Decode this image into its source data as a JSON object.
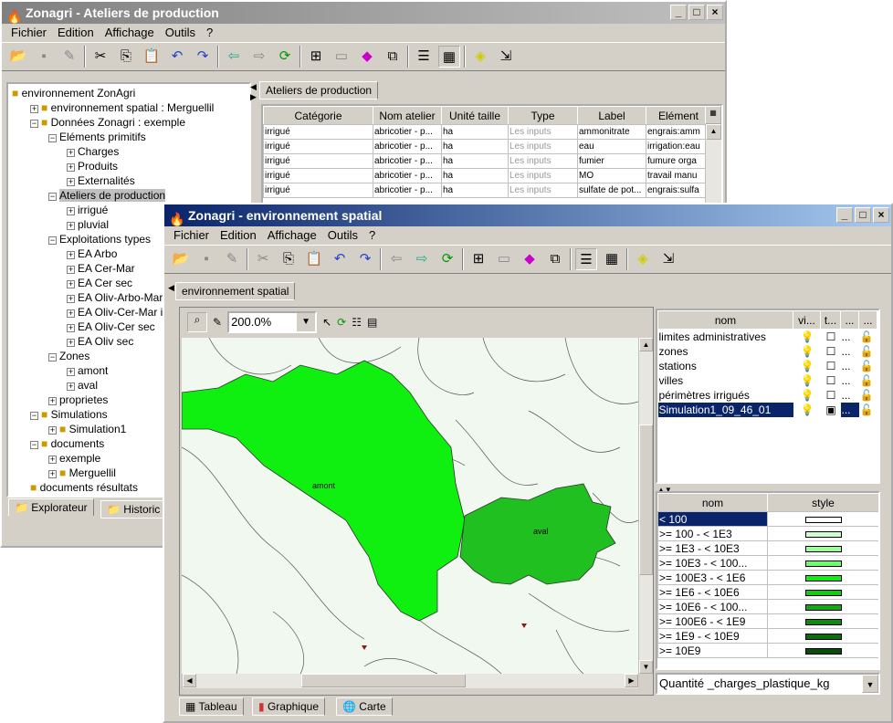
{
  "back_window": {
    "title": "Zonagri - Ateliers de production",
    "menu": [
      "Fichier",
      "Edition",
      "Affichage",
      "Outils",
      "?"
    ],
    "tree": [
      {
        "label": "environnement ZonAgri",
        "level": 0,
        "expander": "",
        "icon": "environment-icon"
      },
      {
        "label": "environnement spatial : Merguellil",
        "level": 1,
        "expander": "+",
        "icon": "globe-icon"
      },
      {
        "label": "Données Zonagri : exemple",
        "level": 1,
        "expander": "-",
        "icon": "shortcut-icon"
      },
      {
        "label": "Eléments primitifs",
        "level": 2,
        "expander": "-"
      },
      {
        "label": "Charges",
        "level": 3,
        "expander": "+"
      },
      {
        "label": "Produits",
        "level": 3,
        "expander": "+"
      },
      {
        "label": "Externalités",
        "level": 3,
        "expander": "+"
      },
      {
        "label": "Ateliers de production",
        "level": 2,
        "expander": "-",
        "selected": true
      },
      {
        "label": "irrigué",
        "level": 3,
        "expander": "+"
      },
      {
        "label": "pluvial",
        "level": 3,
        "expander": "+"
      },
      {
        "label": "Exploitations types",
        "level": 2,
        "expander": "-"
      },
      {
        "label": "EA Arbo",
        "level": 3,
        "expander": "+"
      },
      {
        "label": "EA Cer-Mar",
        "level": 3,
        "expander": "+"
      },
      {
        "label": "EA Cer sec",
        "level": 3,
        "expander": "+"
      },
      {
        "label": "EA Oliv-Arbo-Mar",
        "level": 3,
        "expander": "+"
      },
      {
        "label": "EA Oliv-Cer-Mar irr",
        "level": 3,
        "expander": "+"
      },
      {
        "label": "EA Oliv-Cer sec",
        "level": 3,
        "expander": "+"
      },
      {
        "label": "EA Oliv sec",
        "level": 3,
        "expander": "+"
      },
      {
        "label": "Zones",
        "level": 2,
        "expander": "-"
      },
      {
        "label": "amont",
        "level": 3,
        "expander": "+"
      },
      {
        "label": "aval",
        "level": 3,
        "expander": "+"
      },
      {
        "label": "proprietes",
        "level": 2,
        "expander": "+"
      },
      {
        "label": "Simulations",
        "level": 1,
        "expander": "-",
        "icon": "simulation-icon"
      },
      {
        "label": "Simulation1",
        "level": 2,
        "expander": "+",
        "icon": "simulation-icon"
      },
      {
        "label": "documents",
        "level": 1,
        "expander": "-",
        "icon": "folder-icon"
      },
      {
        "label": "exemple",
        "level": 2,
        "expander": "+"
      },
      {
        "label": "Merguellil",
        "level": 2,
        "expander": "+",
        "icon": "globe-icon"
      },
      {
        "label": "documents résultats",
        "level": 1,
        "expander": "",
        "icon": "results-icon"
      }
    ],
    "bottom_tabs": [
      "Explorateur",
      "Historic"
    ],
    "content_tab": "Ateliers de production",
    "table": {
      "columns": [
        "Catégorie",
        "Nom atelier",
        "Unité taille",
        "Type",
        "Label",
        "Elément"
      ],
      "rows": [
        [
          "irrigué",
          "abricotier - p...",
          "ha",
          "Les inputs",
          "ammonitrate",
          "engrais:amm"
        ],
        [
          "irrigué",
          "abricotier - p...",
          "ha",
          "Les inputs",
          "eau",
          "irrigation:eau"
        ],
        [
          "irrigué",
          "abricotier - p...",
          "ha",
          "Les inputs",
          "fumier",
          "fumure orga"
        ],
        [
          "irrigué",
          "abricotier - p...",
          "ha",
          "Les inputs",
          "MO",
          "travail manu"
        ],
        [
          "irrigué",
          "abricotier - p...",
          "ha",
          "Les inputs",
          "sulfate de pot...",
          "engrais:sulfa"
        ]
      ]
    }
  },
  "front_window": {
    "title": "Zonagri - environnement spatial",
    "menu": [
      "Fichier",
      "Edition",
      "Affichage",
      "Outils",
      "?"
    ],
    "content_tab": "environnement spatial",
    "zoom_value": "200.0%",
    "map_labels": {
      "amont": "amont",
      "aval": "aval"
    },
    "layers": {
      "columns": [
        "nom",
        "vi...",
        "t...",
        "...",
        "..."
      ],
      "rows": [
        {
          "nom": "limites administratives",
          "c3": "..."
        },
        {
          "nom": "zones",
          "c3": "..."
        },
        {
          "nom": "stations",
          "c3": "..."
        },
        {
          "nom": "villes",
          "c3": "..."
        },
        {
          "nom": "périmètres irrigués",
          "c3": "..."
        },
        {
          "nom": "Simulation1_09_46_01",
          "c3": "...",
          "selected": true
        }
      ]
    },
    "legend": {
      "columns": [
        "nom",
        "style"
      ],
      "rows": [
        {
          "nom": "< 100",
          "color": "#ffffff"
        },
        {
          "nom": ">= 100 - < 1E3",
          "color": "#ccffcc"
        },
        {
          "nom": ">= 1E3 - < 10E3",
          "color": "#99ff99"
        },
        {
          "nom": ">= 10E3 - < 100...",
          "color": "#66ff66"
        },
        {
          "nom": ">= 100E3 - < 1E6",
          "color": "#11ee11"
        },
        {
          "nom": ">= 1E6 - < 10E6",
          "color": "#11cc11"
        },
        {
          "nom": ">= 10E6 - < 100...",
          "color": "#10aa10"
        },
        {
          "nom": ">= 100E6 - < 1E9",
          "color": "#0c8c0c"
        },
        {
          "nom": ">= 1E9 - < 10E9",
          "color": "#087008"
        },
        {
          "nom": ">= 10E9",
          "color": "#045004"
        }
      ]
    },
    "quantity_select": "Quantité _charges_plastique_kg",
    "bottom_tabs": [
      "Tableau",
      "Graphique",
      "Carte"
    ]
  }
}
